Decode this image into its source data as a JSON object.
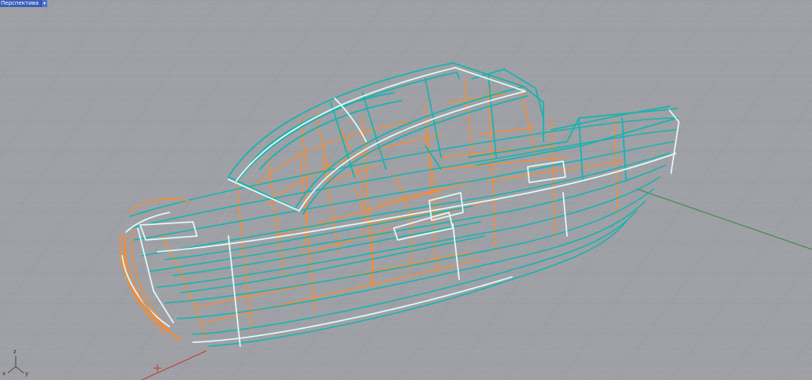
{
  "viewport": {
    "title": "Перспектива",
    "menu_arrow": "▾"
  },
  "axis_widget": {
    "z_label": "z",
    "x_label": "x",
    "y_label": "y"
  },
  "colors": {
    "background": "#9ea0a5",
    "grid_minor": "#aeb0b5",
    "grid_major": "#8e9095",
    "hull_wire": "#19b3b0",
    "hull_wire_highlight": "#8ff3f0",
    "frame_wire": "#ff8a2a",
    "selection_edge": "#e0f8f6",
    "x_axis": "#c0392b",
    "y_axis": "#2e8b3a",
    "tab_bg": "#3a5fb8"
  },
  "icons": {
    "viewport_menu": "dropdown-arrow-icon",
    "axis_widget": "xyz-axis-icon"
  }
}
